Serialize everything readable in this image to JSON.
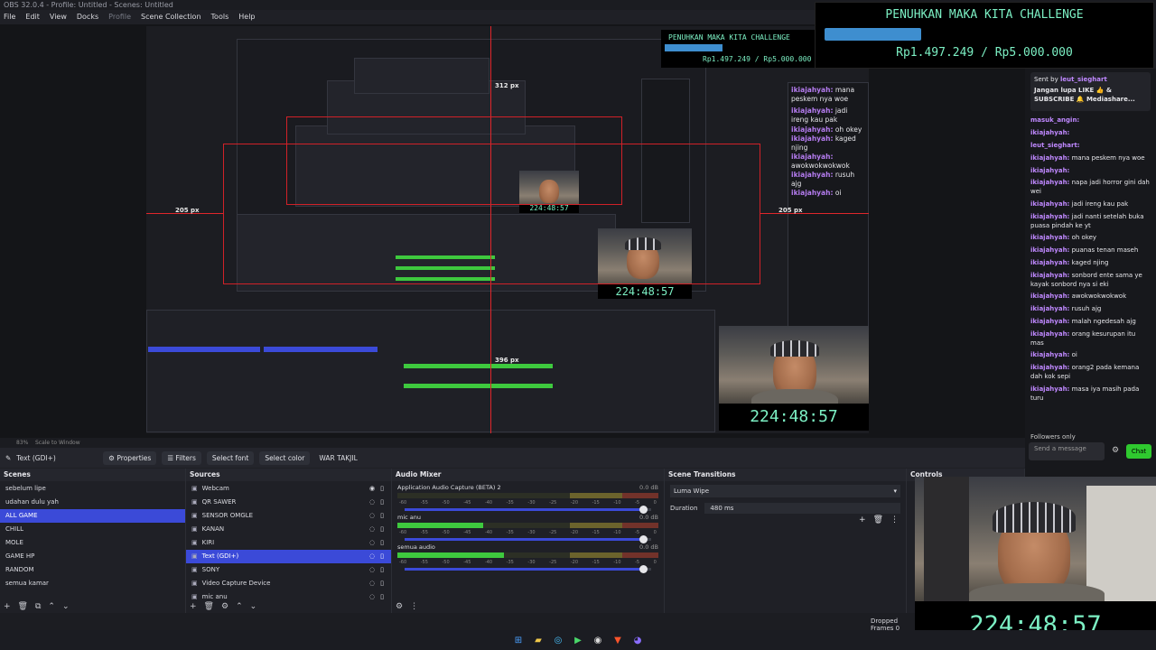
{
  "window": {
    "title": "OBS 32.0.4 - Profile: Untitled - Scenes: Untitled"
  },
  "menu": [
    "File",
    "Edit",
    "View",
    "Docks",
    "Profile",
    "Scene Collection",
    "Tools",
    "Help"
  ],
  "donation": {
    "title": "PENUHKAN MAKA KITA CHALLENGE",
    "amount": "Rp1.497.249 / Rp5.000.000",
    "progress": 0.3
  },
  "preview": {
    "px_labels": {
      "left": "205 px",
      "top": "312 px",
      "bottom": "396 px",
      "right": "205 px"
    },
    "timer": "224:48:57"
  },
  "context": {
    "source_name": "Text (GDI+)",
    "properties": "Properties",
    "filters": "Filters",
    "select_font": "Select font",
    "select_color": "Select color",
    "text_value": "WAR TAKJIL",
    "zoom": "83%",
    "scale_mode": "Scale to Window"
  },
  "scenes": {
    "title": "Scenes",
    "items": [
      "sebelum lipe",
      "udahan dulu yah",
      "ALL GAME",
      "CHILL",
      "MOLE",
      "GAME HP",
      "RANDOM",
      "semua kamar"
    ],
    "selected": 2
  },
  "sources": {
    "title": "Sources",
    "items": [
      "Webcam",
      "QR SAWER",
      "SENSOR OMGLE",
      "KANAN",
      "KIRI",
      "Text (GDI+)",
      "SONY",
      "Video Capture Device",
      "mic anu"
    ],
    "selected": 5
  },
  "mixer": {
    "title": "Audio Mixer",
    "channels": [
      {
        "name": "Application Audio Capture (BETA) 2",
        "db": "0.0 dB",
        "level": 0.0,
        "volume": 0.97
      },
      {
        "name": "mic anu",
        "db": "0.0 dB",
        "level": 0.33,
        "volume": 0.97
      },
      {
        "name": "semua audio",
        "db": "0.0 dB",
        "level": 0.41,
        "volume": 0.97
      }
    ],
    "ticks": [
      "-60",
      "-55",
      "-50",
      "-45",
      "-40",
      "-35",
      "-30",
      "-25",
      "-20",
      "-15",
      "-10",
      "-5",
      "0"
    ]
  },
  "transitions": {
    "title": "Scene Transitions",
    "current": "Luma Wipe",
    "duration_label": "Duration",
    "duration": "480 ms"
  },
  "controls": {
    "title": "Controls"
  },
  "status": {
    "dropped": "Dropped Frames 0"
  },
  "chat": {
    "header_sent_by": "Sent by",
    "header_user": "leut_sieghart",
    "pinned": "Jangan lupa LIKE 👍 & SUBSCRIBE 🔔 Mediashare...",
    "messages": [
      {
        "user": "masuk_angin:",
        "text": ""
      },
      {
        "user": "ikiajahyah:",
        "text": ""
      },
      {
        "user": "leut_sieghart:",
        "text": ""
      },
      {
        "user": "ikiajahyah:",
        "text": "mana peskem nya woe"
      },
      {
        "user": "ikiajahyah:",
        "text": ""
      },
      {
        "user": "ikiajahyah:",
        "text": "napa jadi horror gini dah wei"
      },
      {
        "user": "ikiajahyah:",
        "text": "jadi ireng kau pak"
      },
      {
        "user": "ikiajahyah:",
        "text": "jadi nanti setelah buka puasa pindah ke yt"
      },
      {
        "user": "ikiajahyah:",
        "text": "oh okey"
      },
      {
        "user": "ikiajahyah:",
        "text": "puanas tenan maseh"
      },
      {
        "user": "ikiajahyah:",
        "text": "kaged njing"
      },
      {
        "user": "ikiajahyah:",
        "text": "sonbord ente sama ye kayak sonbord nya si eki"
      },
      {
        "user": "ikiajahyah:",
        "text": "awokwokwokwok"
      },
      {
        "user": "ikiajahyah:",
        "text": "rusuh ajg"
      },
      {
        "user": "ikiajahyah:",
        "text": "malah ngedesah ajg"
      },
      {
        "user": "ikiajahyah:",
        "text": "orang kesurupan itu mas"
      },
      {
        "user": "ikiajahyah:",
        "text": "oi"
      },
      {
        "user": "ikiajahyah:",
        "text": "orang2 pada kemana dah kok sepi"
      },
      {
        "user": "ikiajahyah:",
        "text": "masa iya masih pada turu"
      }
    ],
    "followers_only": "Followers only",
    "send_placeholder": "Send a message",
    "chat_button": "Chat"
  },
  "colors": {
    "accent": "#3b4ad8",
    "timer": "#7cf0c4",
    "redguide": "#e0262b",
    "chat_button": "#2fc92f"
  }
}
